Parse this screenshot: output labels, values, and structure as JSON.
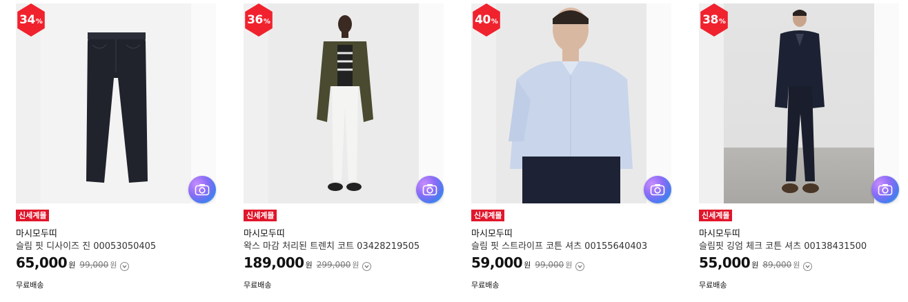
{
  "products": [
    {
      "discount": "34",
      "discount_unit": "%",
      "badge": "신세계몰",
      "brand": "마시모두띠",
      "name": "슬림 핏 디사이즈 진 00053050405",
      "price": "65,000",
      "original_price": "99,000",
      "currency": "원",
      "shipping": "무료배송"
    },
    {
      "discount": "36",
      "discount_unit": "%",
      "badge": "신세계몰",
      "brand": "마시모두띠",
      "name": "왁스 마감 처리된 트렌치 코트 03428219505",
      "price": "189,000",
      "original_price": "299,000",
      "currency": "원",
      "shipping": "무료배송"
    },
    {
      "discount": "40",
      "discount_unit": "%",
      "badge": "신세계몰",
      "brand": "마시모두띠",
      "name": "슬림 핏 스트라이프 코튼 셔츠 00155640403",
      "price": "59,000",
      "original_price": "99,000",
      "currency": "원",
      "shipping": "무료배송"
    },
    {
      "discount": "38",
      "discount_unit": "%",
      "badge": "신세계몰",
      "brand": "마시모두띠",
      "name": "슬림핏 깅엄 체크 코튼 셔츠 00138431500",
      "price": "55,000",
      "original_price": "89,000",
      "currency": "원",
      "shipping": "무료배송"
    }
  ],
  "colors": {
    "discount_badge": "#f0222e",
    "store_badge": "#e0162b"
  },
  "icons": {
    "image_search": "camera-icon",
    "price_info": "chevron-down-circle-icon"
  }
}
